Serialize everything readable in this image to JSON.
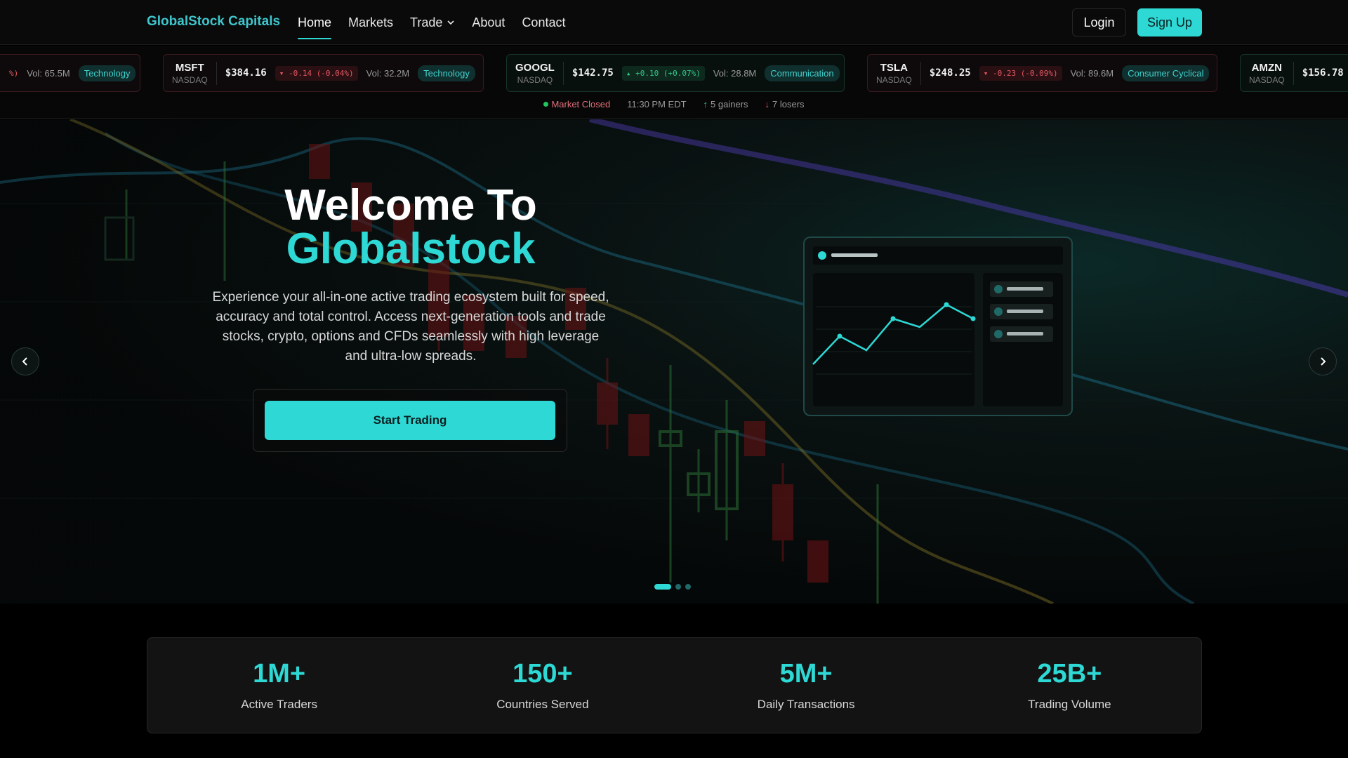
{
  "nav": {
    "brand": "GlobalStock Capitals",
    "links": [
      "Home",
      "Markets",
      "Trade",
      "About",
      "Contact"
    ],
    "login": "Login",
    "signup": "Sign Up"
  },
  "ticker": {
    "cards": [
      {
        "symbol": "",
        "exchange": "",
        "price": "",
        "change": "%)",
        "volume": "Vol: 65.5M",
        "sector": "Technology",
        "direction": "down"
      },
      {
        "symbol": "MSFT",
        "exchange": "NASDAQ",
        "price": "$384.16",
        "change": "-0.14 (-0.04%)",
        "volume": "Vol: 32.2M",
        "sector": "Technology",
        "direction": "down"
      },
      {
        "symbol": "GOOGL",
        "exchange": "NASDAQ",
        "price": "$142.75",
        "change": "+0.10 (+0.07%)",
        "volume": "Vol: 28.8M",
        "sector": "Communication",
        "direction": "up"
      },
      {
        "symbol": "TSLA",
        "exchange": "NASDAQ",
        "price": "$248.25",
        "change": "-0.23 (-0.09%)",
        "volume": "Vol: 89.6M",
        "sector": "Consumer Cyclical",
        "direction": "down"
      },
      {
        "symbol": "AMZN",
        "exchange": "NASDAQ",
        "price": "$156.78",
        "change": "",
        "volume": "",
        "sector": "",
        "direction": "up"
      }
    ],
    "status": {
      "market": "Market Closed",
      "time": "11:30 PM EDT",
      "gainers": "5 gainers",
      "losers": "7 losers"
    }
  },
  "hero": {
    "title_line1": "Welcome To",
    "title_line2": "Globalstock",
    "description": "Experience your all-in-one active trading ecosystem built for speed, accuracy and total control. Access next-generation tools and trade stocks, crypto, options and CFDs seamlessly with high leverage and ultra-low spreads.",
    "cta": "Start Trading",
    "slides": 3,
    "active_slide": 1
  },
  "stats": [
    {
      "value": "1M+",
      "label": "Active Traders"
    },
    {
      "value": "150+",
      "label": "Countries Served"
    },
    {
      "value": "5M+",
      "label": "Daily Transactions"
    },
    {
      "value": "25B+",
      "label": "Trading Volume"
    }
  ],
  "colors": {
    "accent": "#2ed8d4",
    "up": "#34c78a",
    "down": "#e25762",
    "background": "#000000"
  }
}
